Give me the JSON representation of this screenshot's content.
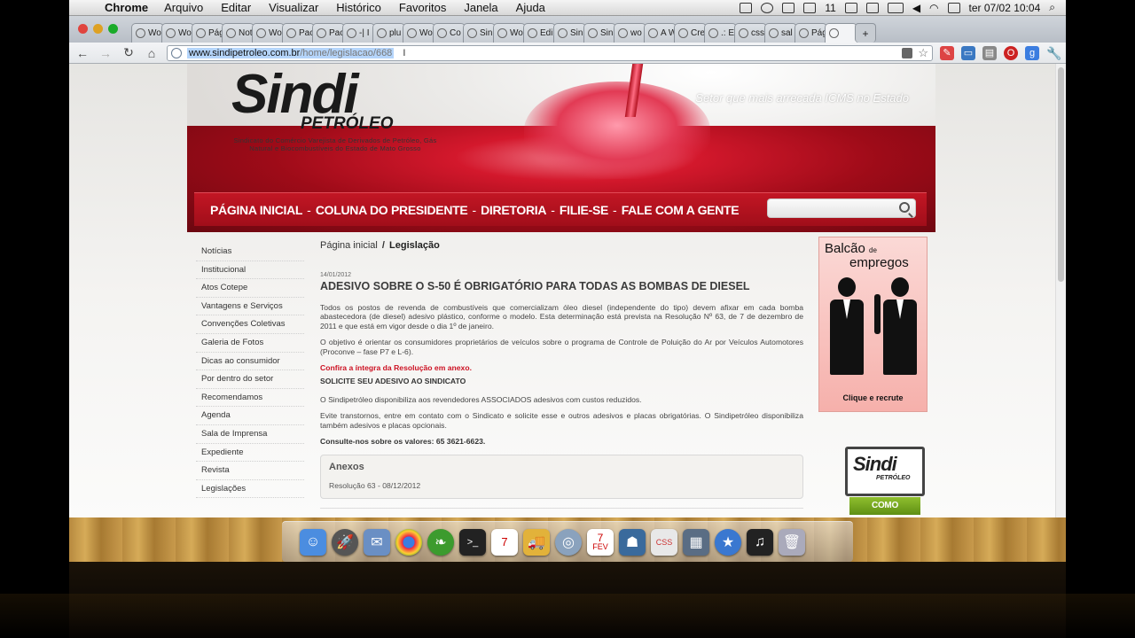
{
  "menubar": {
    "app": "Chrome",
    "menus": [
      "Arquivo",
      "Editar",
      "Visualizar",
      "Histórico",
      "Favoritos",
      "Janela",
      "Ajuda"
    ],
    "status": {
      "badge": "11",
      "datetime": "ter 07/02  10:04"
    }
  },
  "browser": {
    "tabs": [
      "Wo",
      "Wo",
      "Pág",
      "Not",
      "Wo",
      "Pac",
      "Pac",
      "-| I",
      "plu",
      "Wo",
      "Co",
      "Sin",
      "Wo",
      "Edi",
      "Sin",
      "Sin",
      "wo",
      "A W",
      "Cre",
      ".: E",
      "css",
      "sal",
      "Pág",
      ""
    ],
    "active_tab_index": 23,
    "url_host": "www.sindipetroleo.com.br",
    "url_path": "/home/legislacao/668"
  },
  "site": {
    "logo_word": "Sindi",
    "logo_sub": "PETRÓLEO",
    "logo_desc": "Sindicato do Comércio Varejista de Derivados de Petróleo, Gás Natural e Biocombustíveis do Estado de Mato Grosso",
    "slogan": "Setor que mais arrecada ICMS no Estado",
    "nav": [
      "PÁGINA INICIAL",
      "COLUNA DO PRESIDENTE",
      "DIRETORIA",
      "FILIE-SE",
      "FALE COM A GENTE"
    ],
    "nav_separator": "-",
    "search_placeholder": ""
  },
  "sidebar": {
    "items": [
      "Notícias",
      "Institucional",
      "Atos Cotepe",
      "Vantagens e Serviços",
      "Convenções Coletivas",
      "Galeria de Fotos",
      "Dicas ao consumidor",
      "Por dentro do setor",
      "Recomendamos",
      "Agenda",
      "Sala de Imprensa",
      "Expediente",
      "Revista",
      "Legislações"
    ]
  },
  "main": {
    "breadcrumb_home": "Página inicial",
    "breadcrumb_sep": "/",
    "breadcrumb_current": "Legislação",
    "date": "14/01/2012",
    "title": "ADESIVO SOBRE O S-50 É OBRIGATÓRIO PARA TODAS AS BOMBAS DE DIESEL",
    "p1": "Todos os postos de revenda de combustíveis que comercializam óleo diesel (independente do tipo) devem afixar em cada bomba abastecedora (de diesel) adesivo plástico, conforme o modelo. Esta determinação está prevista na Resolução Nº 63, de 7 de dezembro de 2011 e que está em vigor desde o dia 1º de janeiro.",
    "p2": "O objetivo é orientar os consumidores proprietários de veículos sobre o programa de Controle de Poluição do Ar por Veículos Automotores (Proconve – fase P7 e L-6).",
    "p3": "Confira a íntegra da Resolução em anexo.",
    "p4": "SOLICITE SEU ADESIVO AO SINDICATO",
    "p5": "O Sindipetróleo disponibiliza aos revendedores ASSOCIADOS adesivos com custos reduzidos.",
    "p6": "Evite transtornos, entre em contato com o Sindicato e solicite esse e outros adesivos e placas obrigatórias. O Sindipetróleo disponibiliza também adesivos e placas opcionais.",
    "p7": "Consulte-nos sobre os valores: 65 3621-6623.",
    "anexos_title": "Anexos",
    "anexo_file": "Resolução 63 - 08/12/2012"
  },
  "banners": {
    "balcao_1": "Balcão",
    "balcao_de": "de",
    "balcao_2": "empregos",
    "balcao_cta": "Clique e  recrute",
    "sindi_word": "Sindi",
    "sindi_sub": "PETRÓLEO",
    "como_funciona": "COMO FUNCIONA"
  },
  "dock": {
    "calendar_day": "7",
    "calendar_month": "FEV"
  },
  "colors": {
    "brand_red": "#b5121f",
    "accent_green": "#7aa823",
    "link_red": "#cc1122"
  }
}
